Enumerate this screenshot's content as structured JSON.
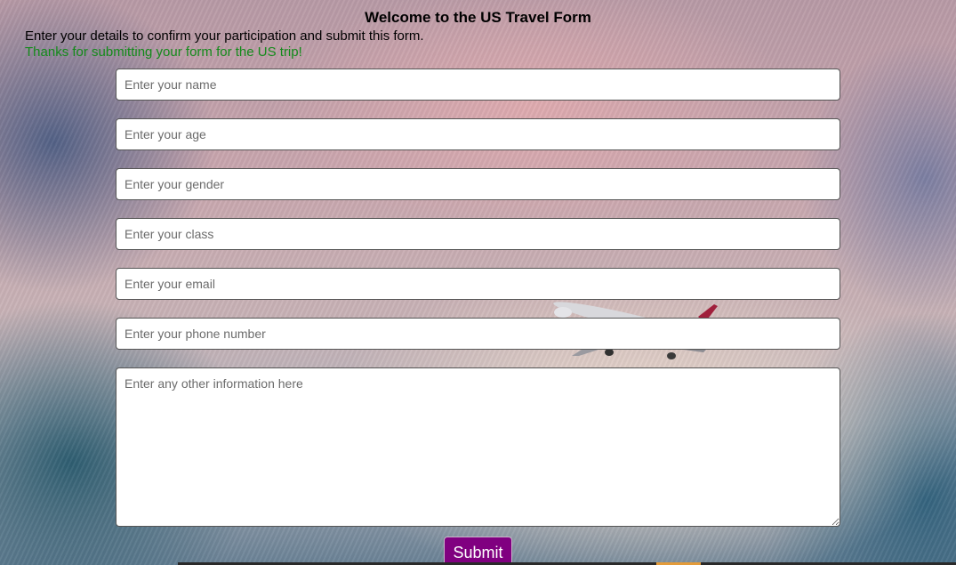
{
  "page": {
    "title": "Welcome to the US Travel Form",
    "intro": "Enter your details to confirm your participation and submit this form.",
    "success_message": "Thanks for submitting your form for the US trip!"
  },
  "form": {
    "name_placeholder": "Enter your name",
    "age_placeholder": "Enter your age",
    "gender_placeholder": "Enter your gender",
    "class_placeholder": "Enter your class",
    "email_placeholder": "Enter your email",
    "phone_placeholder": "Enter your phone number",
    "other_placeholder": "Enter any other information here",
    "submit_label": "Submit"
  },
  "colors": {
    "success": "#138a1a",
    "submit_background": "#800080"
  }
}
